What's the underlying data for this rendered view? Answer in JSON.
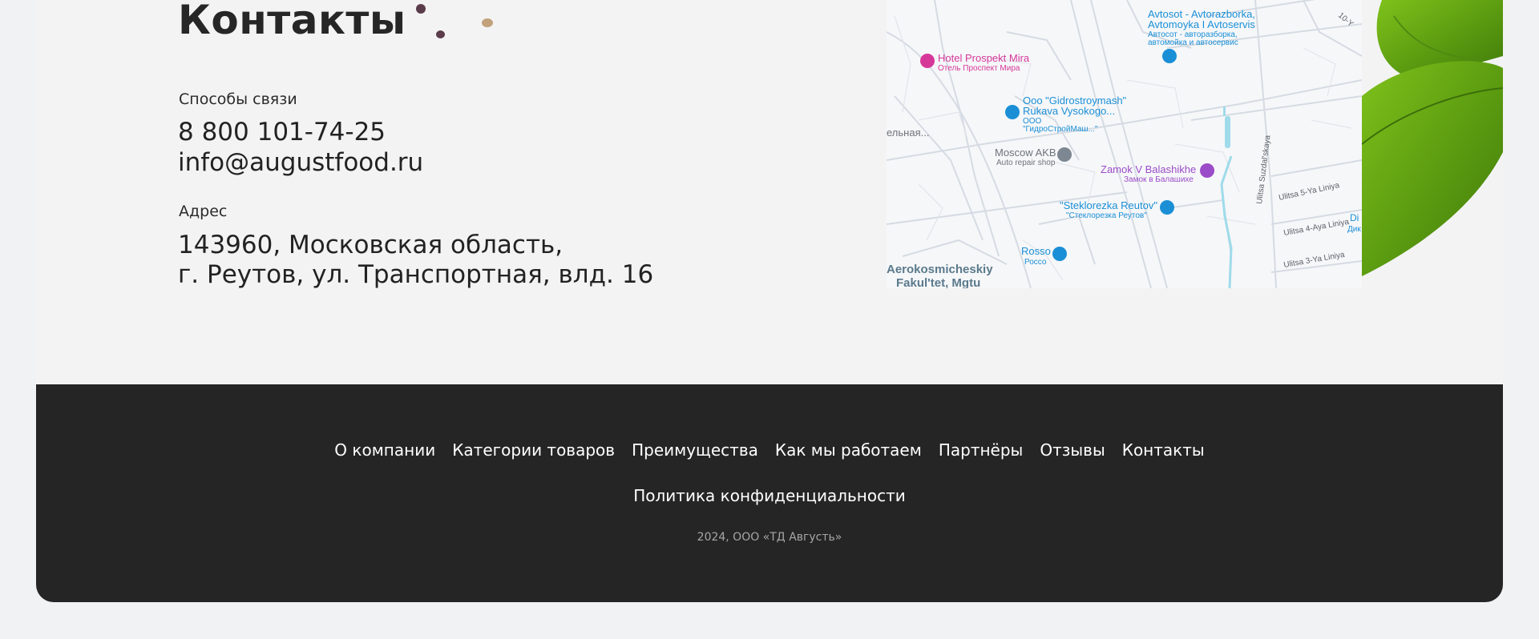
{
  "contacts": {
    "title": "Контакты",
    "contact_label": "Способы связи",
    "phone": "8 800 101-74-25",
    "email": "info@augustfood.ru",
    "address_label": "Адрес",
    "address_line1": "143960, Московская область,",
    "address_line2": "г. Реутов, ул. Транспортная, влд. 16"
  },
  "map": {
    "labels": {
      "avtosot": "Avtosot - Avtorazborka,",
      "avtosot2": "Avtomoyka I Avtoservis",
      "avtosot_ru": "Автосот - авторазборка,",
      "avtosot_ru2": "автомойка и автосервис",
      "hotel": "Hotel Prospekt Mira",
      "hotel_ru": "Отель Проспект Мира",
      "gidro": "Ooo \"Gidrostroymash\"",
      "gidro2": "Rukava Vysokogo...",
      "gidro_ru": "ООО",
      "gidro_ru2": "\"ГидроСтройМаш...\"",
      "street_left": "ельная...",
      "moscow_akb": "Moscow AKB",
      "auto_repair": "Auto repair shop",
      "zamok": "Zamok V Balashikhe",
      "zamok_ru": "Замок в Балашихе",
      "steklo": "\"Steklorezka Reutov\"",
      "steklo_ru": "\"Стеклорезка Реутов\"",
      "rosso": "Rosso",
      "rosso_ru": "Россо",
      "aero1": "Aerokosmicheskiy",
      "aero2": "Fakul'tet, Mgtu",
      "suzdal": "Ulitsa Suzdal'skaya",
      "liniya5": "Ulitsa 5-Ya Liniya",
      "liniya4": "Ulitsa 4-Aya Liniya",
      "liniya3": "Ulitsa 3-Ya Liniya",
      "di1": "Di",
      "di2": "Дик",
      "top_right": "10-Y"
    },
    "colors": {
      "road": "#d5dbe3",
      "water": "#9fdbea",
      "blue_poi": "#1a8fd6",
      "pink_poi": "#d6389a",
      "purple_poi": "#9b4cc8",
      "gray_poi": "#7c8792"
    }
  },
  "footer": {
    "nav": [
      "О компании",
      "Категории товаров",
      "Преимущества",
      "Как мы работаем",
      "Партнёры",
      "Отзывы",
      "Контакты"
    ],
    "policy": "Политика конфиденциальности",
    "copyright": "2024, ООО «ТД Августь»"
  },
  "colors": {
    "page_bg": "#f1f2f4",
    "card_bg": "#f3f3f4",
    "footer_bg": "#252525",
    "text": "#232323",
    "muted": "#a6a6a6"
  }
}
